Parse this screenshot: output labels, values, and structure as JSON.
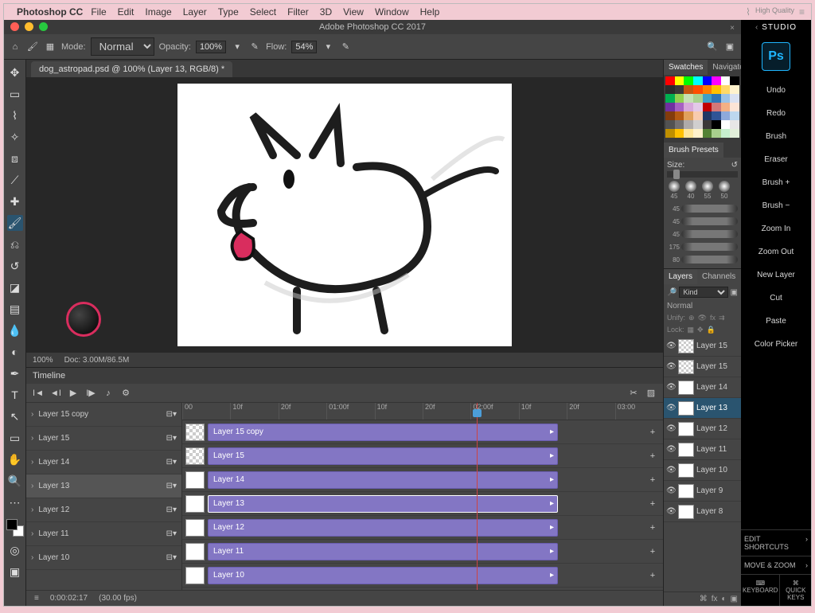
{
  "mac_menu": {
    "app": "Photoshop CC",
    "items": [
      "File",
      "Edit",
      "Image",
      "Layer",
      "Type",
      "Select",
      "Filter",
      "3D",
      "View",
      "Window",
      "Help"
    ],
    "right_status": "High Quality"
  },
  "window_title": "Adobe Photoshop CC 2017",
  "options_bar": {
    "mode_label": "Mode:",
    "mode_value": "Normal",
    "opacity_label": "Opacity:",
    "opacity_value": "100%",
    "flow_label": "Flow:",
    "flow_value": "54%"
  },
  "doc_tab": "dog_astropad.psd @ 100% (Layer 13, RGB/8) *",
  "status": {
    "zoom": "100%",
    "doc": "Doc: 3.00M/86.5M"
  },
  "timeline": {
    "title": "Timeline",
    "ruler": [
      "00",
      "10f",
      "20f",
      "01:00f",
      "10f",
      "20f",
      "02:00f",
      "10f",
      "20f",
      "03:00"
    ],
    "tracks": [
      {
        "name": "Layer 15 copy",
        "sel": false
      },
      {
        "name": "Layer 15",
        "sel": false
      },
      {
        "name": "Layer 14",
        "sel": false
      },
      {
        "name": "Layer 13",
        "sel": true
      },
      {
        "name": "Layer 12",
        "sel": false
      },
      {
        "name": "Layer 11",
        "sel": false
      },
      {
        "name": "Layer 10",
        "sel": false
      }
    ],
    "clips": [
      {
        "name": "Layer 15 copy",
        "transp": true,
        "sel": false
      },
      {
        "name": "Layer 15",
        "transp": true,
        "sel": false
      },
      {
        "name": "Layer 14",
        "transp": false,
        "sel": false
      },
      {
        "name": "Layer 13",
        "transp": false,
        "sel": true
      },
      {
        "name": "Layer 12",
        "transp": false,
        "sel": false
      },
      {
        "name": "Layer 11",
        "transp": false,
        "sel": false
      },
      {
        "name": "Layer 10",
        "transp": false,
        "sel": false
      }
    ],
    "footer_time": "0:00:02:17",
    "footer_fps": "(30.00 fps)",
    "playhead_label": "20f"
  },
  "panels": {
    "swatches_tab": "Swatches",
    "navigator_tab": "Navigato",
    "brush_presets_tab": "Brush Presets",
    "size_label": "Size:",
    "brush_tips": [
      "45",
      "40",
      "55",
      "50"
    ],
    "strokes": [
      "45",
      "45",
      "45",
      "175",
      "80"
    ],
    "layers_tab": "Layers",
    "channels_tab": "Channels",
    "kind_label": "Kind",
    "blend_mode": "Normal",
    "unify_label": "Unify:",
    "lock_label": "Lock:",
    "layers": [
      {
        "name": "Layer 15",
        "transp": true,
        "sel": false
      },
      {
        "name": "Layer 15",
        "transp": true,
        "sel": false
      },
      {
        "name": "Layer 14",
        "transp": false,
        "sel": false
      },
      {
        "name": "Layer 13",
        "transp": false,
        "sel": true
      },
      {
        "name": "Layer 12",
        "transp": false,
        "sel": false
      },
      {
        "name": "Layer 11",
        "transp": false,
        "sel": false
      },
      {
        "name": "Layer 10",
        "transp": false,
        "sel": false
      },
      {
        "name": "Layer 9",
        "transp": false,
        "sel": false
      },
      {
        "name": "Layer 8",
        "transp": false,
        "sel": false
      }
    ]
  },
  "studio": {
    "title": "STUDIO",
    "items": [
      "Undo",
      "Redo",
      "Brush",
      "Eraser",
      "Brush +",
      "Brush −",
      "Zoom In",
      "Zoom Out",
      "New Layer",
      "Cut",
      "Paste",
      "Color Picker"
    ],
    "section_edit": "EDIT SHORTCUTS",
    "section_move": "MOVE & ZOOM",
    "bottom": [
      "KEYBOARD",
      "QUICK KEYS"
    ]
  },
  "swatch_colors": [
    "#ff0000",
    "#ffff00",
    "#00ff00",
    "#00ffff",
    "#0000ff",
    "#ff00ff",
    "#ffffff",
    "#000000",
    "#2b2b2b",
    "#3a3838",
    "#c65611",
    "#ff4d00",
    "#ff7f00",
    "#ffc000",
    "#ffd966",
    "#fff2cc",
    "#00b050",
    "#92d050",
    "#c6e0b4",
    "#a9d08e",
    "#40a0c4",
    "#2e75b6",
    "#9bc2e6",
    "#d9e1f2",
    "#7030a0",
    "#a760c2",
    "#d8a8db",
    "#e3c9e8",
    "#c00000",
    "#d27878",
    "#f4b084",
    "#fce4d6",
    "#833c0c",
    "#b55a12",
    "#e1a15b",
    "#f8cbad",
    "#203764",
    "#305496",
    "#8ea9db",
    "#bdd7ee",
    "#525252",
    "#757171",
    "#aeaaaa",
    "#d0cece",
    "#3a3838",
    "#000000",
    "#ffffff",
    "#e7e6e6",
    "#bf8f00",
    "#ffc000",
    "#ffe699",
    "#fff2cc",
    "#548235",
    "#a9d08e",
    "#c6efce",
    "#e2efda"
  ]
}
